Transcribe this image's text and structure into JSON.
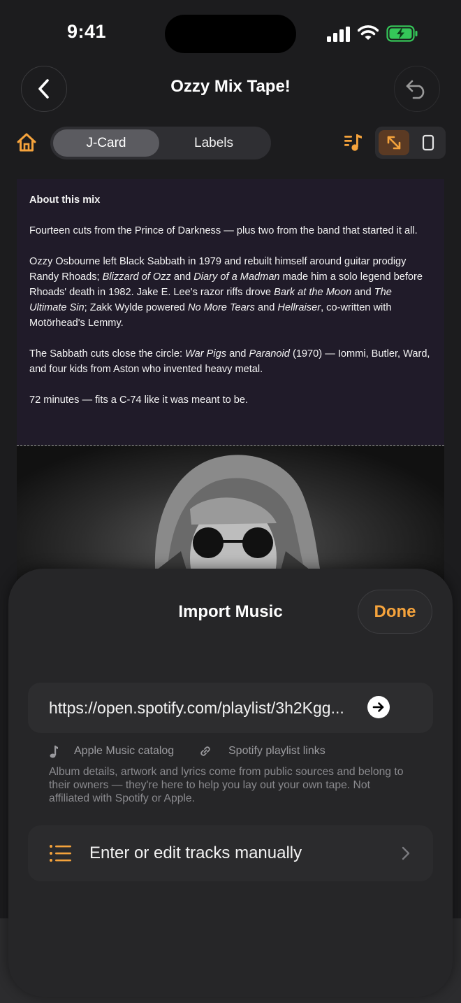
{
  "status_bar": {
    "time": "9:41"
  },
  "nav": {
    "title": "Ozzy Mix Tape!"
  },
  "toolbar": {
    "tabs": [
      {
        "label": "J-Card",
        "active": true
      },
      {
        "label": "Labels",
        "active": false
      }
    ]
  },
  "card": {
    "heading": "About this mix",
    "p1": "Fourteen cuts from the Prince of Darkness — plus two from the band that started it all.",
    "p2": {
      "t1": "Ozzy Osbourne left Black Sabbath in 1979 and rebuilt himself around guitar prodigy Randy Rhoads; ",
      "i1": "Blizzard of Ozz",
      "t2": " and ",
      "i2": "Diary of a Madman",
      "t3": " made him a solo legend before Rhoads' death in 1982. Jake E. Lee's razor riffs drove ",
      "i3": "Bark at the Moon",
      "t4": " and ",
      "i4": "The Ultimate Sin",
      "t5": "; Zakk Wylde powered ",
      "i5": "No More Tears",
      "t6": " and ",
      "i6": "Hellraiser",
      "t7": ", co-written with Motörhead's Lemmy."
    },
    "p3": {
      "t1": "The Sabbath cuts close the circle: ",
      "i1": "War Pigs",
      "t2": " and ",
      "i2": "Paranoid",
      "t3": " (1970) — Iommi, Butler, Ward, and four kids from Aston who invented heavy metal."
    },
    "p4": "72 minutes — fits a C-74 like it was meant to be."
  },
  "sheet": {
    "title": "Import Music",
    "done_label": "Done",
    "url_value": "https://open.spotify.com/playlist/3h2Kgg...",
    "source_apple": "Apple Music catalog",
    "source_spotify": "Spotify playlist links",
    "disclaimer": "Album details, artwork and lyrics come from public sources and belong to their owners — they're here to help you lay out your own tape. Not affiliated with Spotify or Apple.",
    "manual_label": "Enter or edit tracks manually"
  },
  "colors": {
    "accent": "#f5a33c",
    "battery": "#35c759",
    "background": "#1c1c1e",
    "card": "#201b29"
  },
  "icons": [
    "back-arrow-icon",
    "undo-icon",
    "home-icon",
    "playlist-icon",
    "expand-icon",
    "portrait-icon",
    "arrow-right-icon",
    "music-note-icon",
    "link-icon",
    "list-icon",
    "chevron-right-icon"
  ]
}
